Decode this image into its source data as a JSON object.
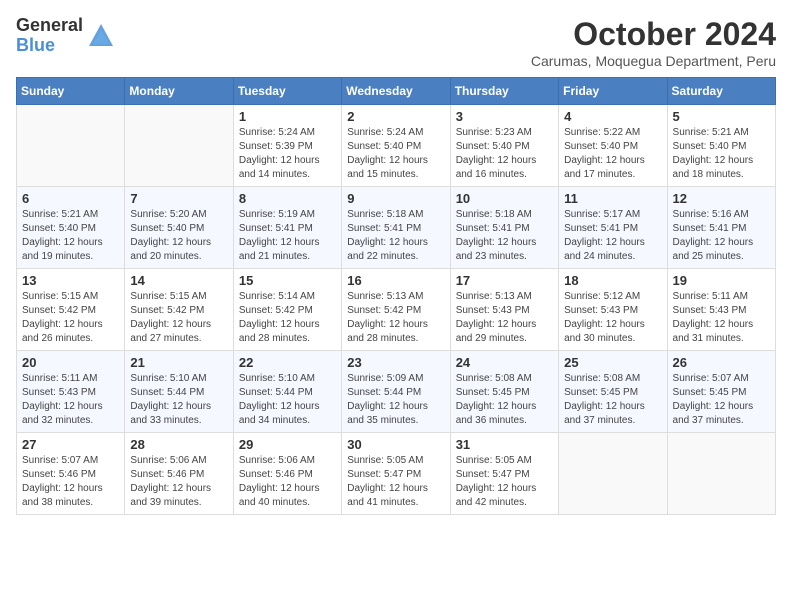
{
  "header": {
    "logo_general": "General",
    "logo_blue": "Blue",
    "month_title": "October 2024",
    "subtitle": "Carumas, Moquegua Department, Peru"
  },
  "days_of_week": [
    "Sunday",
    "Monday",
    "Tuesday",
    "Wednesday",
    "Thursday",
    "Friday",
    "Saturday"
  ],
  "weeks": [
    [
      {
        "day": "",
        "info": ""
      },
      {
        "day": "",
        "info": ""
      },
      {
        "day": "1",
        "info": "Sunrise: 5:24 AM\nSunset: 5:39 PM\nDaylight: 12 hours and 14 minutes."
      },
      {
        "day": "2",
        "info": "Sunrise: 5:24 AM\nSunset: 5:40 PM\nDaylight: 12 hours and 15 minutes."
      },
      {
        "day": "3",
        "info": "Sunrise: 5:23 AM\nSunset: 5:40 PM\nDaylight: 12 hours and 16 minutes."
      },
      {
        "day": "4",
        "info": "Sunrise: 5:22 AM\nSunset: 5:40 PM\nDaylight: 12 hours and 17 minutes."
      },
      {
        "day": "5",
        "info": "Sunrise: 5:21 AM\nSunset: 5:40 PM\nDaylight: 12 hours and 18 minutes."
      }
    ],
    [
      {
        "day": "6",
        "info": "Sunrise: 5:21 AM\nSunset: 5:40 PM\nDaylight: 12 hours and 19 minutes."
      },
      {
        "day": "7",
        "info": "Sunrise: 5:20 AM\nSunset: 5:40 PM\nDaylight: 12 hours and 20 minutes."
      },
      {
        "day": "8",
        "info": "Sunrise: 5:19 AM\nSunset: 5:41 PM\nDaylight: 12 hours and 21 minutes."
      },
      {
        "day": "9",
        "info": "Sunrise: 5:18 AM\nSunset: 5:41 PM\nDaylight: 12 hours and 22 minutes."
      },
      {
        "day": "10",
        "info": "Sunrise: 5:18 AM\nSunset: 5:41 PM\nDaylight: 12 hours and 23 minutes."
      },
      {
        "day": "11",
        "info": "Sunrise: 5:17 AM\nSunset: 5:41 PM\nDaylight: 12 hours and 24 minutes."
      },
      {
        "day": "12",
        "info": "Sunrise: 5:16 AM\nSunset: 5:41 PM\nDaylight: 12 hours and 25 minutes."
      }
    ],
    [
      {
        "day": "13",
        "info": "Sunrise: 5:15 AM\nSunset: 5:42 PM\nDaylight: 12 hours and 26 minutes."
      },
      {
        "day": "14",
        "info": "Sunrise: 5:15 AM\nSunset: 5:42 PM\nDaylight: 12 hours and 27 minutes."
      },
      {
        "day": "15",
        "info": "Sunrise: 5:14 AM\nSunset: 5:42 PM\nDaylight: 12 hours and 28 minutes."
      },
      {
        "day": "16",
        "info": "Sunrise: 5:13 AM\nSunset: 5:42 PM\nDaylight: 12 hours and 28 minutes."
      },
      {
        "day": "17",
        "info": "Sunrise: 5:13 AM\nSunset: 5:43 PM\nDaylight: 12 hours and 29 minutes."
      },
      {
        "day": "18",
        "info": "Sunrise: 5:12 AM\nSunset: 5:43 PM\nDaylight: 12 hours and 30 minutes."
      },
      {
        "day": "19",
        "info": "Sunrise: 5:11 AM\nSunset: 5:43 PM\nDaylight: 12 hours and 31 minutes."
      }
    ],
    [
      {
        "day": "20",
        "info": "Sunrise: 5:11 AM\nSunset: 5:43 PM\nDaylight: 12 hours and 32 minutes."
      },
      {
        "day": "21",
        "info": "Sunrise: 5:10 AM\nSunset: 5:44 PM\nDaylight: 12 hours and 33 minutes."
      },
      {
        "day": "22",
        "info": "Sunrise: 5:10 AM\nSunset: 5:44 PM\nDaylight: 12 hours and 34 minutes."
      },
      {
        "day": "23",
        "info": "Sunrise: 5:09 AM\nSunset: 5:44 PM\nDaylight: 12 hours and 35 minutes."
      },
      {
        "day": "24",
        "info": "Sunrise: 5:08 AM\nSunset: 5:45 PM\nDaylight: 12 hours and 36 minutes."
      },
      {
        "day": "25",
        "info": "Sunrise: 5:08 AM\nSunset: 5:45 PM\nDaylight: 12 hours and 37 minutes."
      },
      {
        "day": "26",
        "info": "Sunrise: 5:07 AM\nSunset: 5:45 PM\nDaylight: 12 hours and 37 minutes."
      }
    ],
    [
      {
        "day": "27",
        "info": "Sunrise: 5:07 AM\nSunset: 5:46 PM\nDaylight: 12 hours and 38 minutes."
      },
      {
        "day": "28",
        "info": "Sunrise: 5:06 AM\nSunset: 5:46 PM\nDaylight: 12 hours and 39 minutes."
      },
      {
        "day": "29",
        "info": "Sunrise: 5:06 AM\nSunset: 5:46 PM\nDaylight: 12 hours and 40 minutes."
      },
      {
        "day": "30",
        "info": "Sunrise: 5:05 AM\nSunset: 5:47 PM\nDaylight: 12 hours and 41 minutes."
      },
      {
        "day": "31",
        "info": "Sunrise: 5:05 AM\nSunset: 5:47 PM\nDaylight: 12 hours and 42 minutes."
      },
      {
        "day": "",
        "info": ""
      },
      {
        "day": "",
        "info": ""
      }
    ]
  ]
}
